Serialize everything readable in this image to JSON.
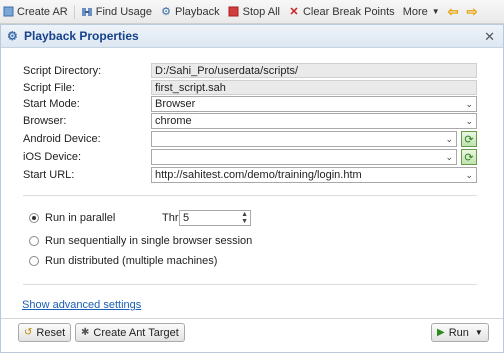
{
  "toolbar": {
    "create_ar": "Create AR",
    "find_usage": "Find Usage",
    "playback": "Playback",
    "stop_all": "Stop All",
    "clear_break_points": "Clear Break Points",
    "more": "More"
  },
  "dialog": {
    "title": "Playback Properties",
    "fields": {
      "script_directory": {
        "label": "Script Directory:",
        "value": "D:/Sahi_Pro/userdata/scripts/"
      },
      "script_file": {
        "label": "Script File:",
        "value": "first_script.sah"
      },
      "start_mode": {
        "label": "Start Mode:",
        "value": "Browser"
      },
      "browser": {
        "label": "Browser:",
        "value": "chrome"
      },
      "android_device": {
        "label": "Android Device:",
        "value": ""
      },
      "ios_device": {
        "label": "iOS Device:",
        "value": ""
      },
      "start_url": {
        "label": "Start URL:",
        "value": "http://sahitest.com/demo/training/login.htm"
      }
    },
    "run_options": {
      "parallel": "Run in parallel",
      "threads_label": "Threads:",
      "threads_value": "5",
      "sequential": "Run sequentially in single browser session",
      "distributed": "Run distributed (multiple machines)"
    },
    "advanced_link": "Show advanced settings",
    "buttons": {
      "reset": "Reset",
      "create_ant_target": "Create Ant Target",
      "run": "Run"
    }
  },
  "colors": {
    "header_text": "#15428b",
    "link": "#1a5fb4",
    "stop_icon": "#d23c3c",
    "clear_icon": "#cc2222",
    "refresh_icon": "#2f7d1f"
  }
}
